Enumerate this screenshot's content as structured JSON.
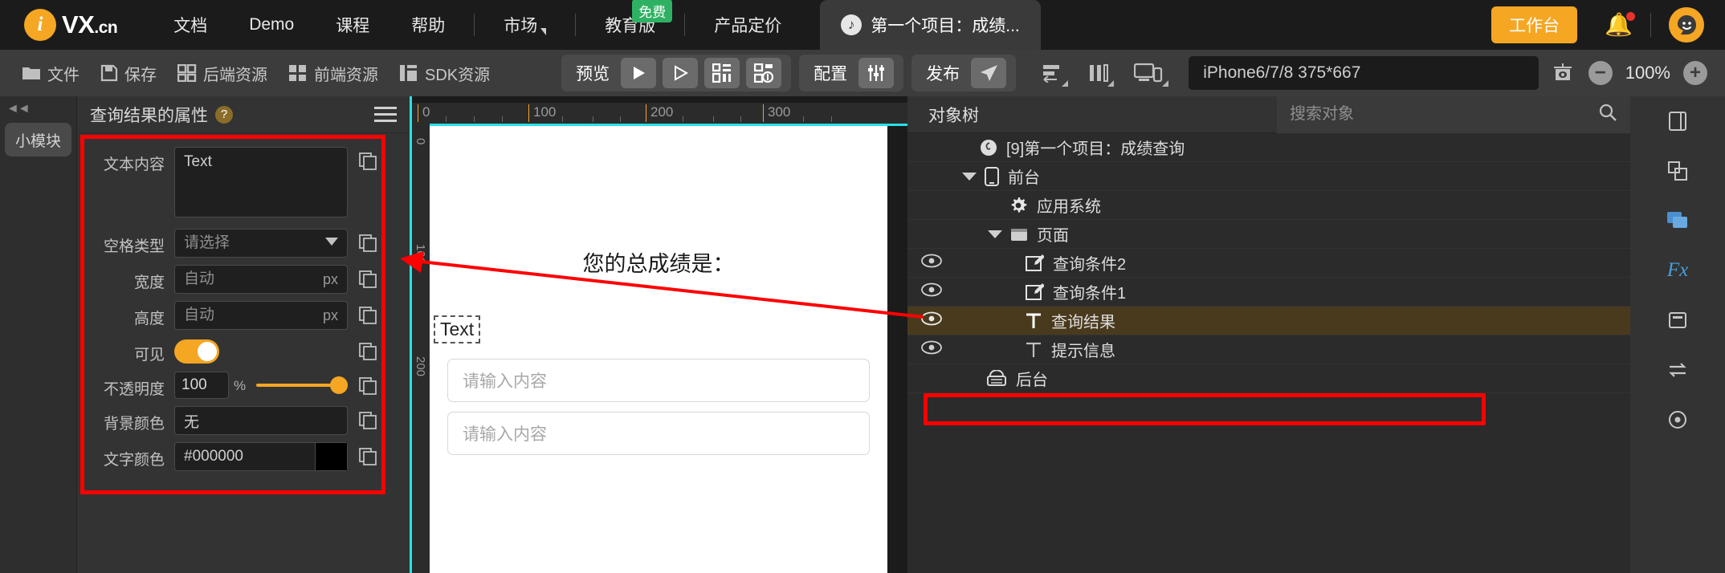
{
  "topnav": {
    "logo_letter": "i",
    "logo_name": "VX",
    "logo_tld": ".cn",
    "items": [
      {
        "label": "文档",
        "icon": "",
        "badge": ""
      },
      {
        "label": "Demo",
        "icon": "",
        "badge": ""
      },
      {
        "label": "课程",
        "icon": "",
        "badge": ""
      },
      {
        "label": "帮助",
        "icon": "",
        "badge": ""
      },
      {
        "label": "市场",
        "icon": "chevron-down-icon",
        "badge": ""
      },
      {
        "label": "教育版",
        "icon": "",
        "badge": "免费"
      },
      {
        "label": "产品定价",
        "icon": "",
        "badge": ""
      }
    ],
    "project_tab": "第一个项目：成绩...",
    "project_icon": "project-logo-icon",
    "workbench": "工作台",
    "bell_icon": "bell-icon",
    "avatar_icon": "user-avatar-icon",
    "accent": "#f5a623",
    "badge_green": "#2fb163",
    "notify_red": "#e8332a"
  },
  "toolbar": {
    "file_buttons": [
      {
        "label": "文件",
        "icon": "folder-icon"
      },
      {
        "label": "保存",
        "icon": "save-icon"
      },
      {
        "label": "后端资源",
        "icon": "backend-grid-icon"
      },
      {
        "label": "前端资源",
        "icon": "frontend-grid-icon"
      },
      {
        "label": "SDK资源",
        "icon": "sdk-icon"
      }
    ],
    "preview_label": "预览",
    "preview_icons": [
      "play-icon",
      "play-outline-icon",
      "qrcode-icon",
      "qrcode-share-icon"
    ],
    "config_label": "配置",
    "config_icon": "sliders-icon",
    "publish_label": "发布",
    "publish_icon": "send-icon",
    "layout_icons": [
      "align-left-icon",
      "columns-icon",
      "responsive-device-icon"
    ],
    "device": "iPhone6/7/8 375*667",
    "eye_icon": "canvas-eye-icon",
    "zoom_out": "−",
    "zoom_value": "100%",
    "zoom_in": "+"
  },
  "left_rail": {
    "collapse_icon": "collapse-left-icon",
    "chip_label": "小模块"
  },
  "properties": {
    "title": "查询结果的属性",
    "help": "?",
    "menu_icon": "hamburger-menu-icon",
    "rows": [
      {
        "label": "文本内容",
        "value": "Text",
        "placeholder": "",
        "type": "textarea",
        "unit": ""
      },
      {
        "label": "空格类型",
        "value": "",
        "placeholder": "请选择",
        "type": "select",
        "unit": ""
      },
      {
        "label": "宽度",
        "value": "",
        "placeholder": "自动",
        "type": "input",
        "unit": "px"
      },
      {
        "label": "高度",
        "value": "",
        "placeholder": "自动",
        "type": "input",
        "unit": "px"
      },
      {
        "label": "可见",
        "value": "",
        "placeholder": "",
        "type": "toggle",
        "unit": ""
      },
      {
        "label": "不透明度",
        "value": "100",
        "placeholder": "",
        "type": "opacity",
        "unit": "%"
      },
      {
        "label": "背景颜色",
        "value": "无",
        "placeholder": "",
        "type": "input",
        "unit": ""
      },
      {
        "label": "文字颜色",
        "value": "#000000",
        "placeholder": "",
        "type": "color",
        "unit": ""
      }
    ],
    "copy_icon": "copy-icon",
    "highlight_color": "#ff0000",
    "toggle_on_color": "#f5a623"
  },
  "canvas": {
    "ruler_marks": [
      "0",
      "100",
      "200",
      "300"
    ],
    "v_marks": [
      "0",
      "100",
      "200"
    ],
    "guide_color": "#29e0e8",
    "heading": "您的总成绩是：",
    "selected_text": "Text",
    "inputs": [
      "请输入内容",
      "请输入内容"
    ]
  },
  "tree": {
    "tab": "对象树",
    "search_placeholder": "搜索对象",
    "search_icon": "search-icon",
    "nodes": [
      {
        "label": "[9]第一个项目：成绩查询",
        "icon": "project-logo-icon",
        "indent": 0,
        "eye": false,
        "expand": "",
        "selected": false
      },
      {
        "label": "前台",
        "icon": "phone-icon",
        "indent": 1,
        "eye": false,
        "expand": "expanded",
        "selected": false
      },
      {
        "label": "应用系统",
        "icon": "gear-icon",
        "indent": 2,
        "eye": false,
        "expand": "",
        "selected": false
      },
      {
        "label": "页面",
        "icon": "page-icon",
        "indent": 2,
        "eye": false,
        "expand": "expanded",
        "selected": false
      },
      {
        "label": "查询条件2",
        "icon": "edit-icon",
        "indent": 3,
        "eye": true,
        "expand": "",
        "selected": false
      },
      {
        "label": "查询条件1",
        "icon": "edit-icon",
        "indent": 3,
        "eye": true,
        "expand": "",
        "selected": false
      },
      {
        "label": "查询结果",
        "icon": "text-T-icon",
        "indent": 3,
        "eye": true,
        "expand": "",
        "selected": true
      },
      {
        "label": "提示信息",
        "icon": "text-T-icon",
        "indent": 3,
        "eye": true,
        "expand": "",
        "selected": false
      },
      {
        "label": "后台",
        "icon": "server-icon",
        "indent": 1,
        "eye": false,
        "expand": "",
        "selected": false
      }
    ],
    "selection_highlight": "#ff0000"
  },
  "right_rail": {
    "icons": [
      {
        "name": "panel-info-icon",
        "glyph": "▯"
      },
      {
        "name": "layers-icon",
        "glyph": "▣"
      },
      {
        "name": "comments-icon",
        "glyph": "▤"
      },
      {
        "name": "fx-icon",
        "glyph": "Fx"
      },
      {
        "name": "clipboard-icon",
        "glyph": "▭"
      },
      {
        "name": "sync-icon",
        "glyph": "⇄"
      },
      {
        "name": "settings-icon",
        "glyph": "◎"
      }
    ]
  },
  "annotation": {
    "arrow_color": "#ff0000"
  }
}
